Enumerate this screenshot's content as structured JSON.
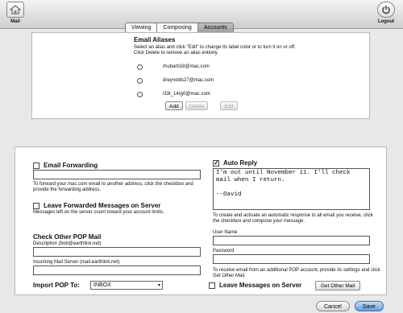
{
  "toolbar": {
    "mail_label": "Mail",
    "logout_label": "Logout"
  },
  "tabs": [
    {
      "label": "Viewing"
    },
    {
      "label": "Composing"
    },
    {
      "label": "Accounts"
    }
  ],
  "aliases": {
    "title": "Email Aliases",
    "description": "Select an alias and click \"Edit\" to change its label color or to turn it on or off. Click Delete to remove an alias entirely.",
    "items": [
      "rhubarb18@mac.com",
      "dreynolds27@mac.com",
      "l33t_14rg0@mac.com"
    ],
    "add_label": "Add",
    "delete_label": "Delete",
    "edit_label": "Edit"
  },
  "forwarding": {
    "title": "Email Forwarding",
    "description": "To forward your mac.com email to another address, click the checkbox and provide the forwarding address.",
    "leave_title": "Leave Forwarded Messages on Server",
    "leave_description": "Messages left on the server count toward your account limits."
  },
  "pop": {
    "title": "Check Other POP Mail",
    "description_label": "Description (bob@earthlink.net)",
    "server_label": "Incoming Mail Server (mail.earthlink.net)",
    "import_label": "Import POP To:",
    "import_value": "INBOX",
    "username_label": "User Name",
    "password_label": "Password",
    "pop_description": "To receive email from an additional POP account, provide its settings and click Get Other Mail.",
    "leave_label": "Leave Messages on Server",
    "get_button": "Get Other Mail"
  },
  "auto_reply": {
    "title": "Auto Reply",
    "message": "I'm out until November 11. I'll check\nmail when I return.\n\n--David",
    "description": "To create and activate an automatic response to all email you receive, click the checkbox and compose your message."
  },
  "footer": {
    "cancel_label": "Cancel",
    "save_label": "Save"
  }
}
